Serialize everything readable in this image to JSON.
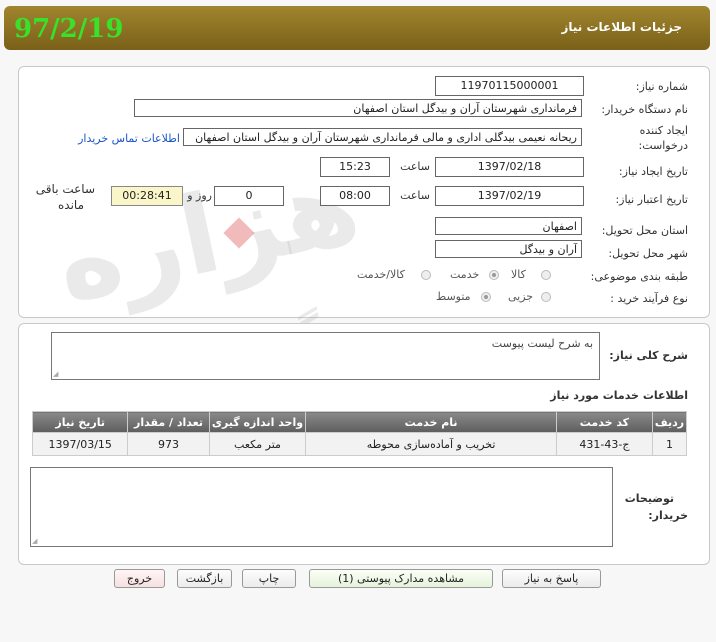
{
  "header": {
    "title": "جزئیات اطلاعات نیاز",
    "date_stamp": "97/2/19"
  },
  "form": {
    "need_number_label": "شماره نیاز:",
    "need_number": "11970115000001",
    "buyer_org_label": "نام دستگاه خریدار:",
    "buyer_org": "فرمانداری شهرستان آران و بیدگل استان اصفهان",
    "creator_label_1": "ایجاد کننده",
    "creator_label_2": "درخواست:",
    "creator": "ریحانه  نعیمی بیدگلی  اداری و مالی  فرمانداری شهرستان آران و بیدگل استان اصفهان",
    "contact_link": "اطلاعات تماس خریدار",
    "created_date_label": "تاریخ ایجاد نیاز:",
    "created_date": "1397/02/18",
    "created_time_label": "ساعت",
    "created_time": "15:23",
    "validity_label": "تاریخ اعتبار نیاز:",
    "validity_date": "1397/02/19",
    "validity_time_label": "ساعت",
    "validity_time": "08:00",
    "days": "0",
    "days_and_label": "روز و",
    "remaining_time": "00:28:41",
    "remaining_label_1": "ساعت باقی",
    "remaining_label_2": "مانده",
    "province_label": "استان محل تحویل:",
    "province": "اصفهان",
    "city_label": "شهر محل تحویل:",
    "city": "آران و بیدگل",
    "category_label": "طبقه بندی موضوعی:",
    "category_options": [
      "کالا",
      "خدمت",
      "کالا/خدمت"
    ],
    "category_selected": "خدمت",
    "process_label": "نوع فرآیند خرید :",
    "process_options": [
      "جزیی",
      "متوسط"
    ],
    "process_selected": "متوسط"
  },
  "description": {
    "label": "شرح کلی نیاز:",
    "text": "به شرح لیست پیوست"
  },
  "services": {
    "title": "اطلاعات خدمات مورد نیاز",
    "columns": [
      "ردیف",
      "کد خدمت",
      "نام خدمت",
      "واحد اندازه گیری",
      "تعداد / مقدار",
      "تاریخ نیاز"
    ],
    "rows": [
      [
        "1",
        "ج-43-431",
        "تخریب و آماده‌سازی محوطه",
        "متر مکعب",
        "973",
        "1397/03/15"
      ]
    ]
  },
  "buyer_notes": {
    "label_1": "توضیحات",
    "label_2": "خریدار:",
    "text": ""
  },
  "buttons": {
    "reply": "پاسخ به نیاز",
    "attachments": "مشاهده مدارک پیوستی (1)",
    "print": "چاپ",
    "back": "بازگشت",
    "exit": "خروج"
  },
  "watermark": {
    "line1": "هزاره",
    "line2": "گستران"
  }
}
